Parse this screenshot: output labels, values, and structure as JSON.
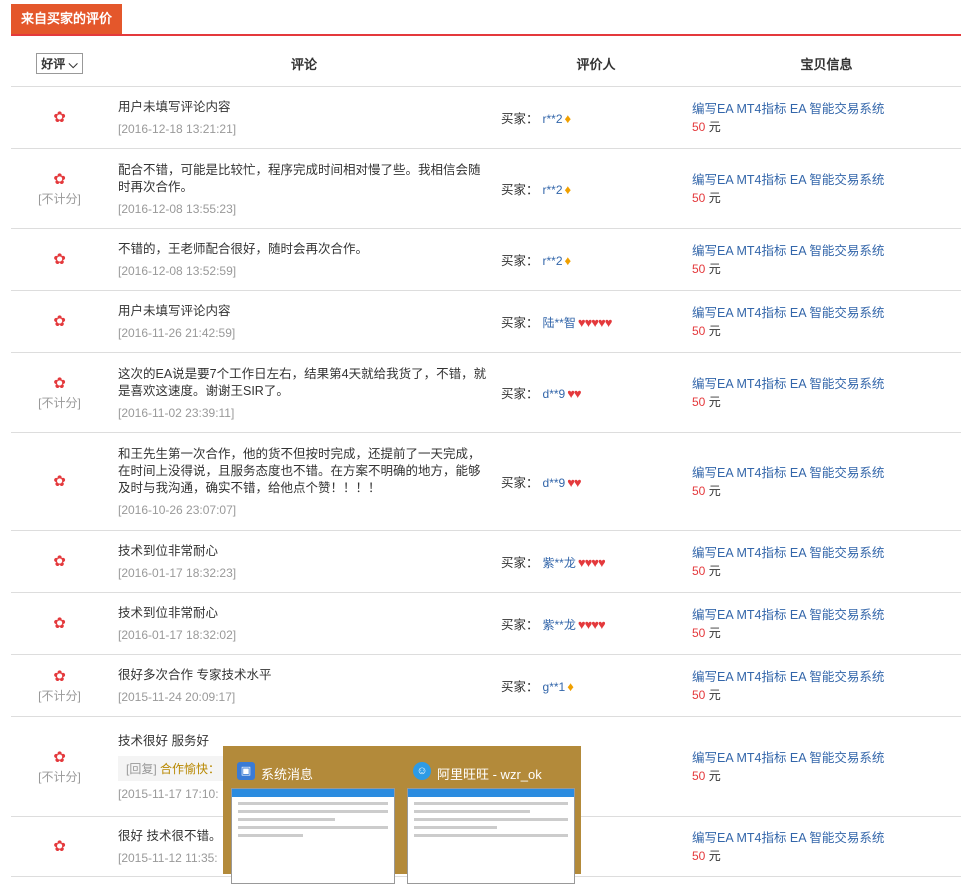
{
  "header": {
    "tab_label": "来自买家的评价"
  },
  "columns": {
    "filter_value": "好评",
    "filter_arrow": "⌵",
    "comment": "评论",
    "reviewer": "评价人",
    "item_info": "宝贝信息"
  },
  "labels": {
    "not_counted": "[不计分]",
    "buyer_prefix": "买家：",
    "item_title": "编写EA MT4指标 EA 智能交易系统",
    "price": "50",
    "price_unit": "元",
    "reply_prefix": "[回复]",
    "flower_icon": "✿"
  },
  "rows": [
    {
      "comment": "用户未填写评论内容",
      "date": "[2016-12-18 13:21:21]",
      "not_counted": false,
      "buyer_prefix": true,
      "buyer": "r**2",
      "badge": "diamond",
      "badge_text": "♦"
    },
    {
      "comment": "配合不错，可能是比较忙，程序完成时间相对慢了些。我相信会随时再次合作。",
      "date": "[2016-12-08 13:55:23]",
      "not_counted": true,
      "buyer_prefix": true,
      "buyer": "r**2",
      "badge": "diamond",
      "badge_text": "♦"
    },
    {
      "comment": "不错的，王老师配合很好，随时会再次合作。",
      "date": "[2016-12-08 13:52:59]",
      "not_counted": false,
      "buyer_prefix": true,
      "buyer": "r**2",
      "badge": "diamond",
      "badge_text": "♦"
    },
    {
      "comment": "用户未填写评论内容",
      "date": "[2016-11-26 21:42:59]",
      "not_counted": false,
      "buyer_prefix": true,
      "buyer": "陆**智",
      "badge": "hearts",
      "badge_text": "♥♥♥♥♥"
    },
    {
      "comment": "这次的EA说是要7个工作日左右，结果第4天就给我货了，不错，就是喜欢这速度。谢谢王SIR了。",
      "date": "[2016-11-02 23:39:11]",
      "not_counted": true,
      "buyer_prefix": true,
      "buyer": "d**9",
      "badge": "hearts",
      "badge_text": "♥♥"
    },
    {
      "comment": "和王先生第一次合作，他的货不但按时完成，还提前了一天完成，在时间上没得说，且服务态度也不错。在方案不明确的地方，能够及时与我沟通，确实不错，给他点个赞！！！！",
      "date": "[2016-10-26 23:07:07]",
      "not_counted": false,
      "buyer_prefix": true,
      "buyer": "d**9",
      "badge": "hearts",
      "badge_text": "♥♥"
    },
    {
      "comment": "技术到位非常耐心",
      "date": "[2016-01-17 18:32:23]",
      "not_counted": false,
      "buyer_prefix": true,
      "buyer": "紫**龙",
      "badge": "hearts",
      "badge_text": "♥♥♥♥"
    },
    {
      "comment": "技术到位非常耐心",
      "date": "[2016-01-17 18:32:02]",
      "not_counted": false,
      "buyer_prefix": true,
      "buyer": "紫**龙",
      "badge": "hearts",
      "badge_text": "♥♥♥♥"
    },
    {
      "comment": "很好多次合作 专家技术水平",
      "date": "[2015-11-24 20:09:17]",
      "not_counted": true,
      "buyer_prefix": true,
      "buyer": "g**1",
      "badge": "diamond",
      "badge_text": "♦"
    },
    {
      "comment": "技术很好 服务好",
      "date": "[2015-11-17 17:10:",
      "not_counted": true,
      "buyer_prefix": false,
      "buyer": "",
      "badge": "",
      "badge_text": "",
      "reply_name": "合作愉快："
    },
    {
      "comment": "很好 技术很不错。 给",
      "date": "[2015-11-12 11:35:",
      "not_counted": false,
      "buyer_prefix": false,
      "buyer": "",
      "badge": "",
      "badge_text": ""
    }
  ],
  "popup": {
    "left_title": "系统消息",
    "right_title": "阿里旺旺 - wzr_ok"
  }
}
